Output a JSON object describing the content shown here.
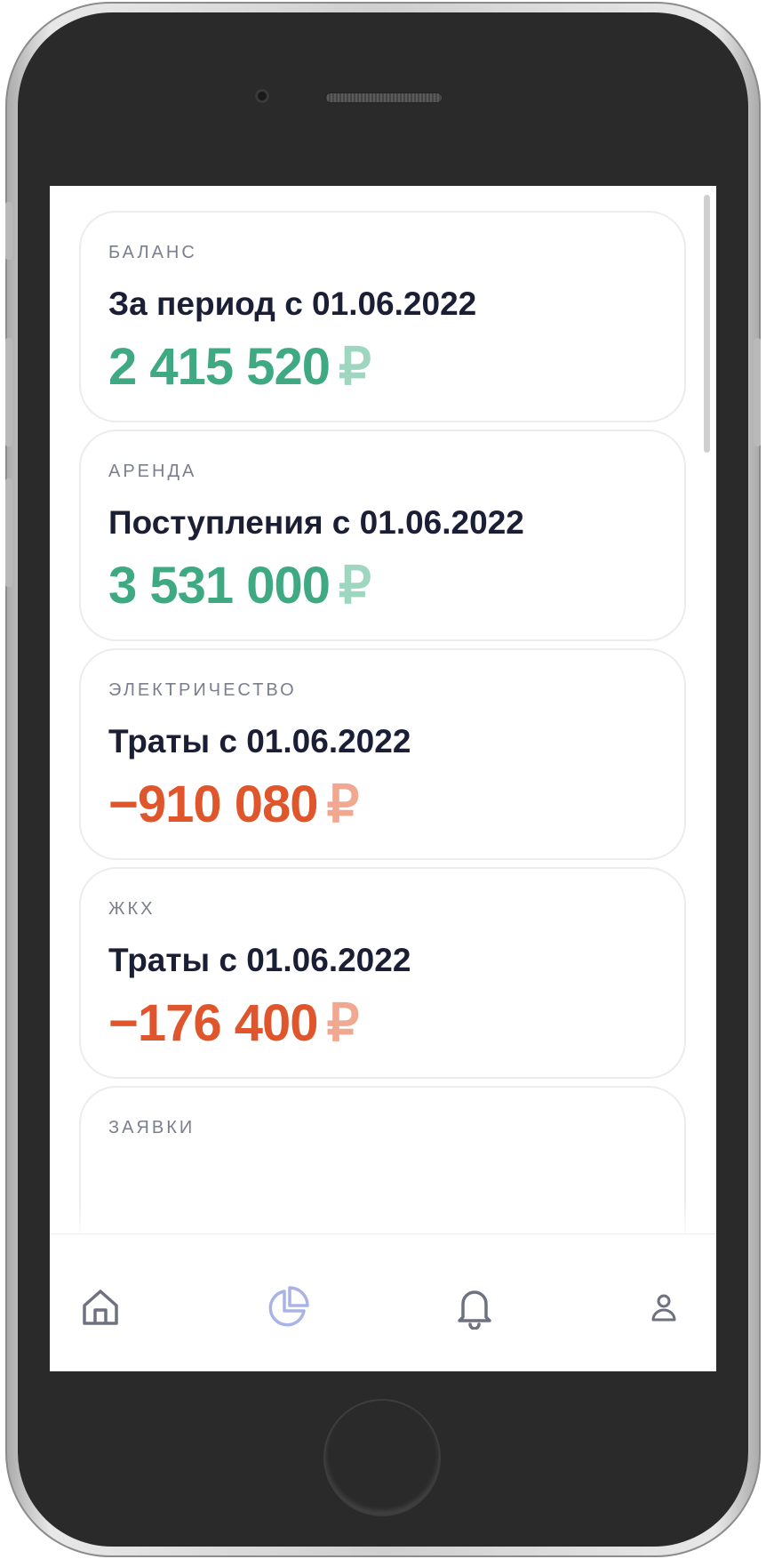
{
  "cards": [
    {
      "caption": "БАЛАНС",
      "title": "За период с 01.06.2022",
      "amount": "2 415 520",
      "currency": "₽",
      "tone": "positive"
    },
    {
      "caption": "АРЕНДА",
      "title": "Поступления с 01.06.2022",
      "amount": "3 531 000",
      "currency": "₽",
      "tone": "positive"
    },
    {
      "caption": "ЭЛЕКТРИЧЕСТВО",
      "title": "Траты с 01.06.2022",
      "amount": "−910 080",
      "currency": "₽",
      "tone": "negative"
    },
    {
      "caption": "ЖКХ",
      "title": "Траты с 01.06.2022",
      "amount": "−176 400",
      "currency": "₽",
      "tone": "negative"
    },
    {
      "caption": "ЗАЯВКИ"
    }
  ],
  "bottom_nav": {
    "items": [
      {
        "icon": "home-icon",
        "active": false
      },
      {
        "icon": "pie-chart-icon",
        "active": true
      },
      {
        "icon": "bell-icon",
        "active": false
      },
      {
        "icon": "user-icon",
        "active": false
      }
    ],
    "active_color": "#a9b3e6",
    "inactive_color": "#6e7180"
  },
  "colors": {
    "positive": "#3fa982",
    "negative": "#e0562c",
    "title": "#1b1f35"
  }
}
